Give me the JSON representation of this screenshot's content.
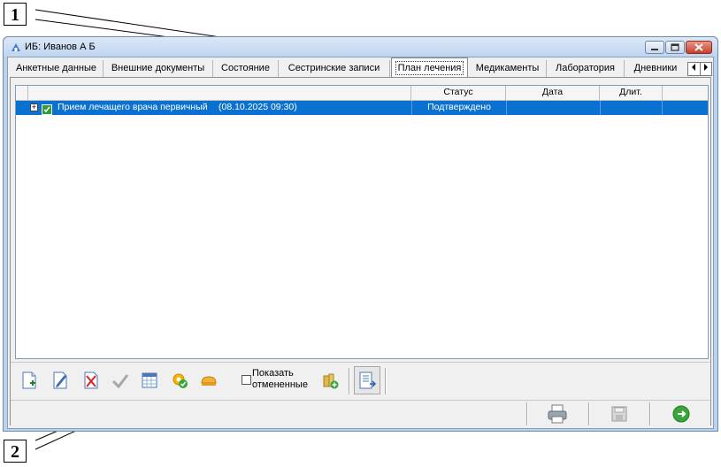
{
  "callouts": {
    "one": "1",
    "two": "2"
  },
  "window": {
    "title": "ИБ: Иванов А Б"
  },
  "tabs": [
    {
      "label": "Анкетные данные"
    },
    {
      "label": "Внешние документы"
    },
    {
      "label": "Состояние"
    },
    {
      "label": "Сестринские записи"
    },
    {
      "label": "План лечения"
    },
    {
      "label": "Медикаменты"
    },
    {
      "label": "Лаборатория"
    },
    {
      "label": "Дневники"
    }
  ],
  "active_tab": "План лечения",
  "grid": {
    "columns": [
      {
        "label": ""
      },
      {
        "label": "Статус"
      },
      {
        "label": "Дата"
      },
      {
        "label": "Длит."
      },
      {
        "label": ""
      }
    ],
    "rows": [
      {
        "expand": "+",
        "name": "Прием лечащего врача первичный",
        "datetime": "(08.10.2025 09:30)",
        "status": "Подтверждено",
        "date": "",
        "duration": ""
      }
    ]
  },
  "toolbar": {
    "checkbox_line1": "Показать",
    "checkbox_line2": "отмененные",
    "checkbox_checked": false,
    "icons": [
      "new-document-icon",
      "edit-icon",
      "delete-icon",
      "check-icon",
      "calendar-icon",
      "gear-check-icon",
      "bread-icon",
      "bottles-add-icon",
      "export-icon"
    ]
  },
  "statusbar": {
    "icons": [
      "printer-icon",
      "save-icon",
      "exit-icon"
    ]
  },
  "colors": {
    "selection": "#0a71d0",
    "accent_close": "#c4402b"
  }
}
